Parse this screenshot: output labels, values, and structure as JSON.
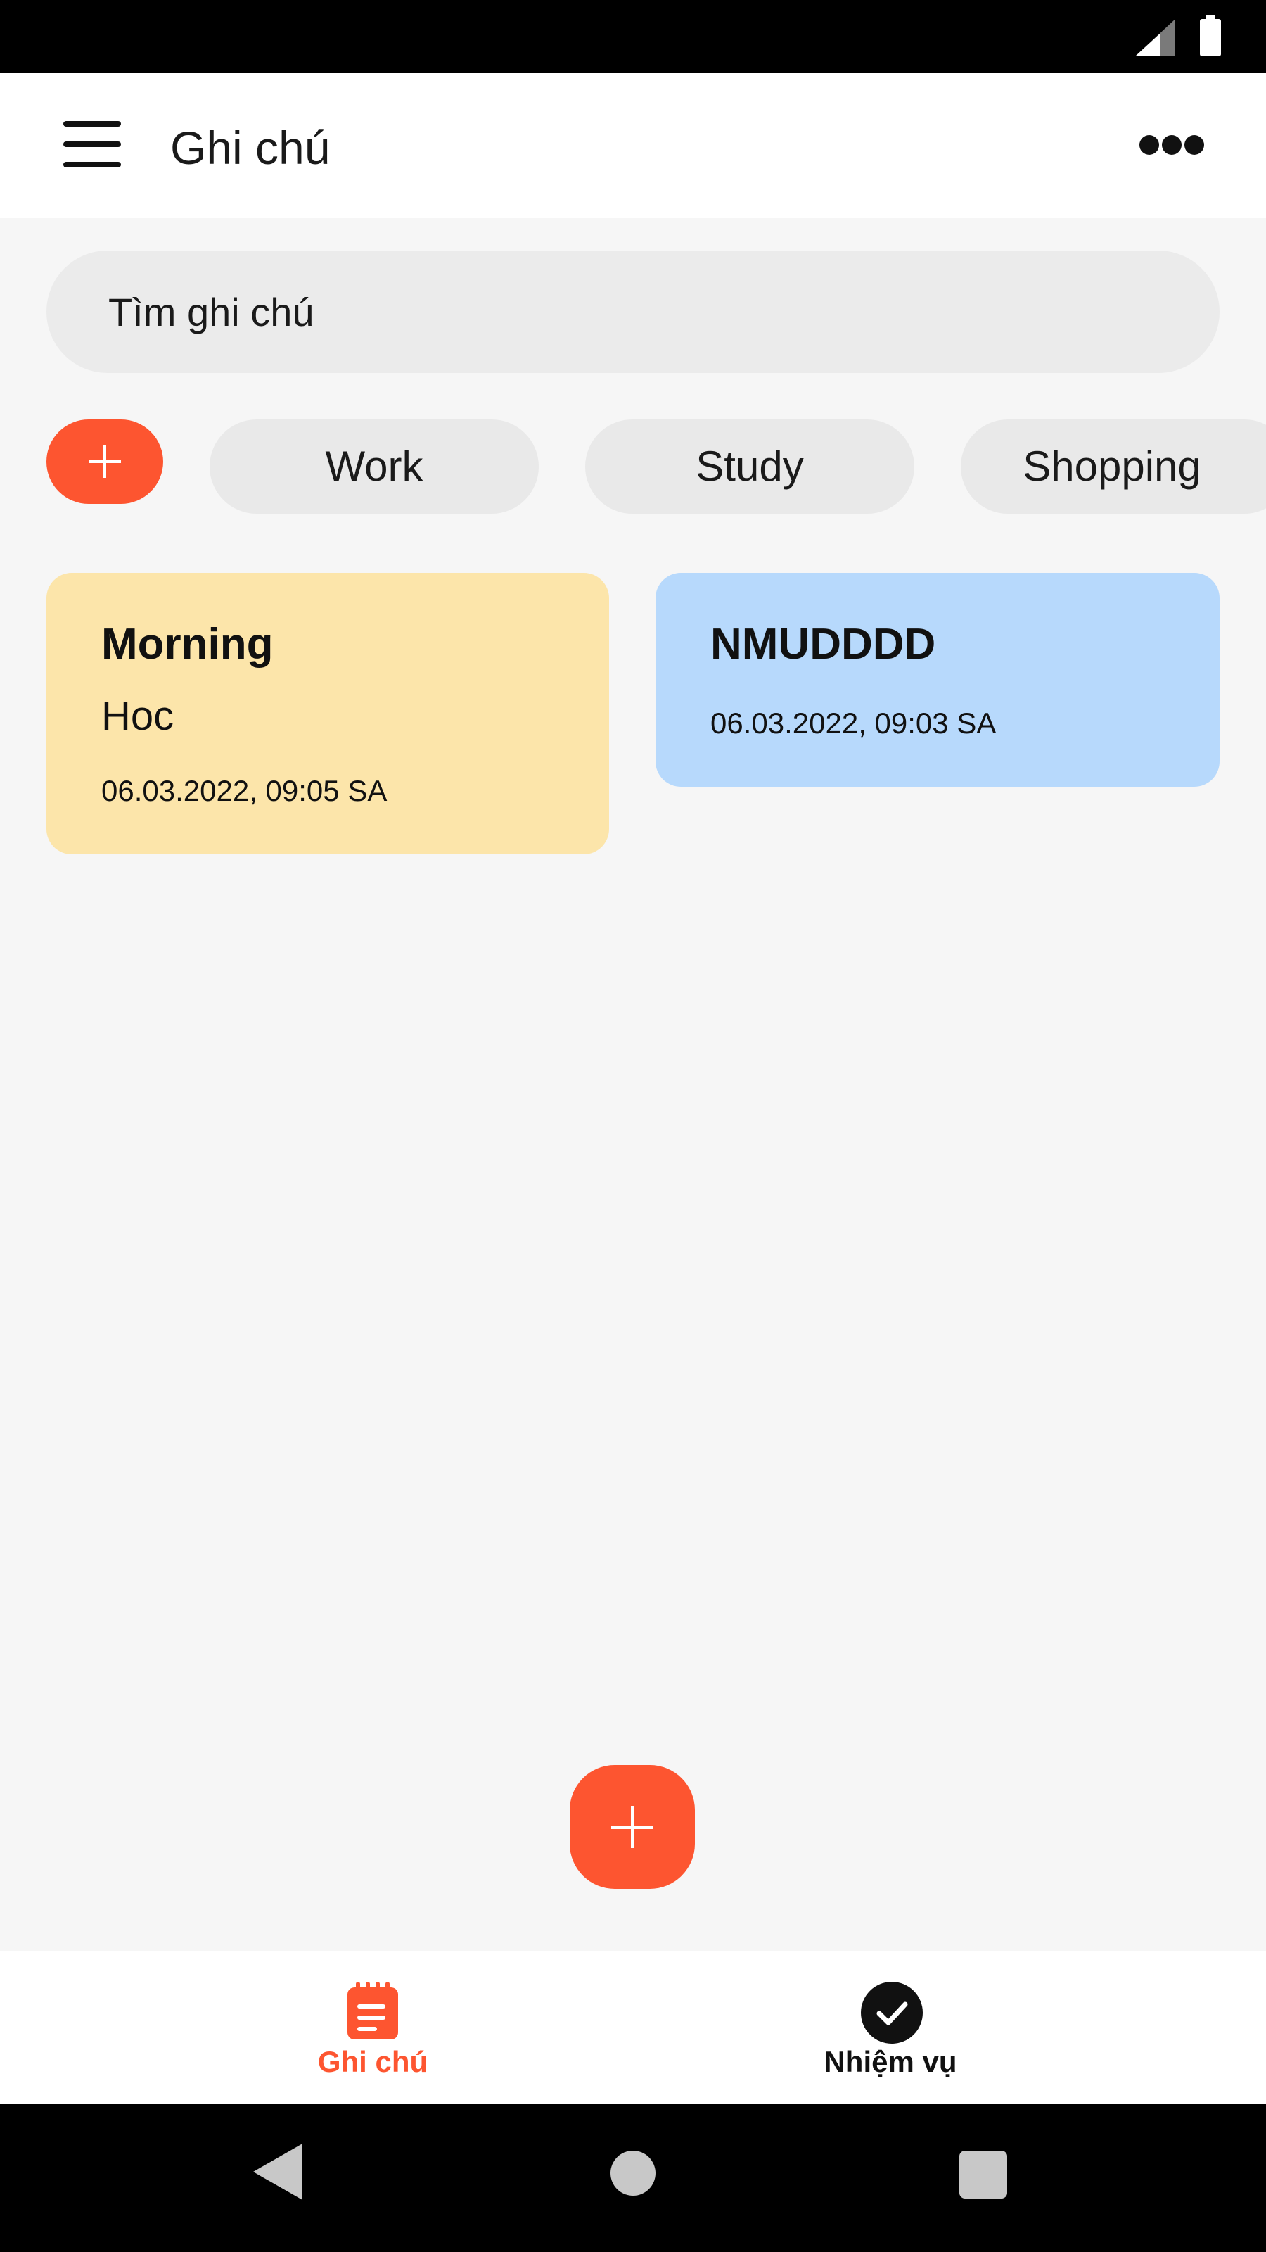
{
  "status_bar": {
    "signal_icon": "signal-icon",
    "battery_icon": "battery-icon"
  },
  "app_bar": {
    "title": "Ghi chú",
    "menu_icon": "hamburger-menu-icon",
    "more_icon": "more-horizontal-icon"
  },
  "search": {
    "placeholder": "Tìm ghi chú",
    "value": ""
  },
  "categories": {
    "add_icon": "plus-icon",
    "chips": [
      {
        "label": "Work"
      },
      {
        "label": "Study"
      },
      {
        "label": "Shopping"
      }
    ]
  },
  "notes": [
    {
      "title": "Morning",
      "body": "Hoc",
      "date": "06.03.2022, 09:05 SA",
      "color": "#fce5aa"
    },
    {
      "title": "NMUDDDD",
      "body": "",
      "date": "06.03.2022, 09:03 SA",
      "color": "#b7d9fc"
    }
  ],
  "fab": {
    "icon": "plus-icon",
    "color": "#fd5530"
  },
  "bottom_nav": {
    "items": [
      {
        "label": "Ghi chú",
        "icon": "notepad-icon",
        "active": true
      },
      {
        "label": "Nhiệm vụ",
        "icon": "check-circle-icon",
        "active": false
      }
    ],
    "active_color": "#fd5530"
  },
  "system_nav": {
    "back_icon": "back-triangle-icon",
    "home_icon": "home-circle-icon",
    "recents_icon": "recents-square-icon"
  }
}
